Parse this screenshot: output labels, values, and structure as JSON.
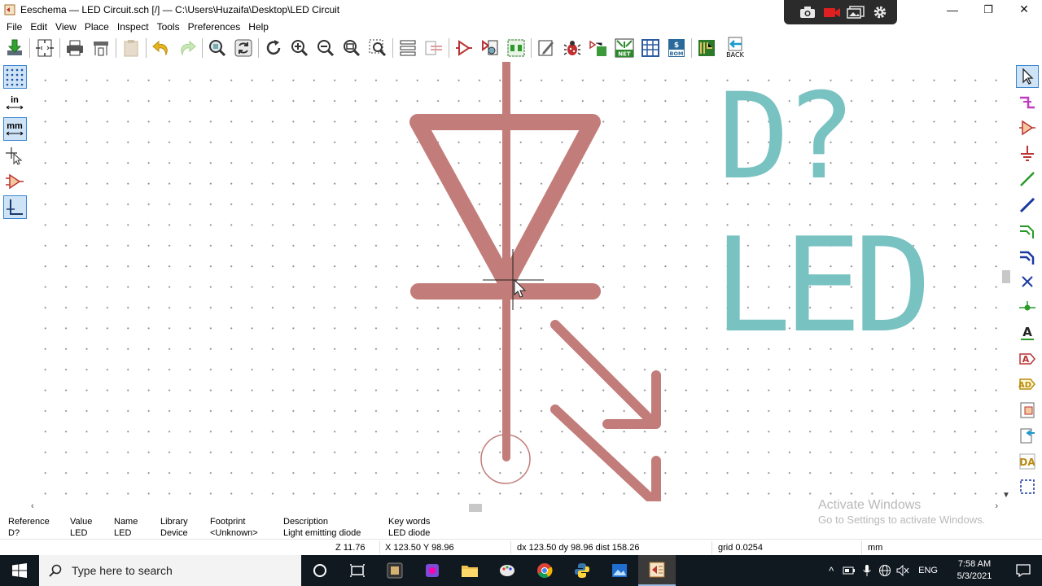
{
  "window": {
    "title": "Eeschema — LED Circuit.sch [/] — C:\\Users\\Huzaifa\\Desktop\\LED Circuit",
    "minimize_glyph": "—",
    "maximize_glyph": "❐",
    "close_glyph": "✕"
  },
  "menu": [
    "File",
    "Edit",
    "View",
    "Place",
    "Inspect",
    "Tools",
    "Preferences",
    "Help"
  ],
  "toolbar": {
    "back_label": "BACK",
    "net_label": "NET",
    "bom_label": "BOM"
  },
  "left_toolbar": {
    "units_in": "in",
    "units_mm": "mm"
  },
  "schematic": {
    "reference": "D?",
    "value": "LED",
    "colors": {
      "body": "#c27d7a",
      "text": "#79c2c2"
    }
  },
  "message_panel": {
    "columns": [
      {
        "header": "Reference",
        "value": "D?"
      },
      {
        "header": "Value",
        "value": "LED"
      },
      {
        "header": "Name",
        "value": "LED"
      },
      {
        "header": "Library",
        "value": "Device"
      },
      {
        "header": "Footprint",
        "value": "<Unknown>"
      },
      {
        "header": "Description",
        "value": "Light emitting diode"
      },
      {
        "header": "Key words",
        "value": "LED diode"
      }
    ]
  },
  "watermark": {
    "line1": "Activate Windows",
    "line2": "Go to Settings to activate Windows."
  },
  "status": {
    "zoom": "Z 11.76",
    "xy": "X 123.50  Y 98.96",
    "delta": "dx 123.50  dy 98.96  dist 158.26",
    "grid": "grid 0.0254",
    "units": "mm"
  },
  "taskbar": {
    "search_placeholder": "Type here to search",
    "language": "ENG",
    "time": "7:58 AM",
    "date": "5/3/2021"
  }
}
